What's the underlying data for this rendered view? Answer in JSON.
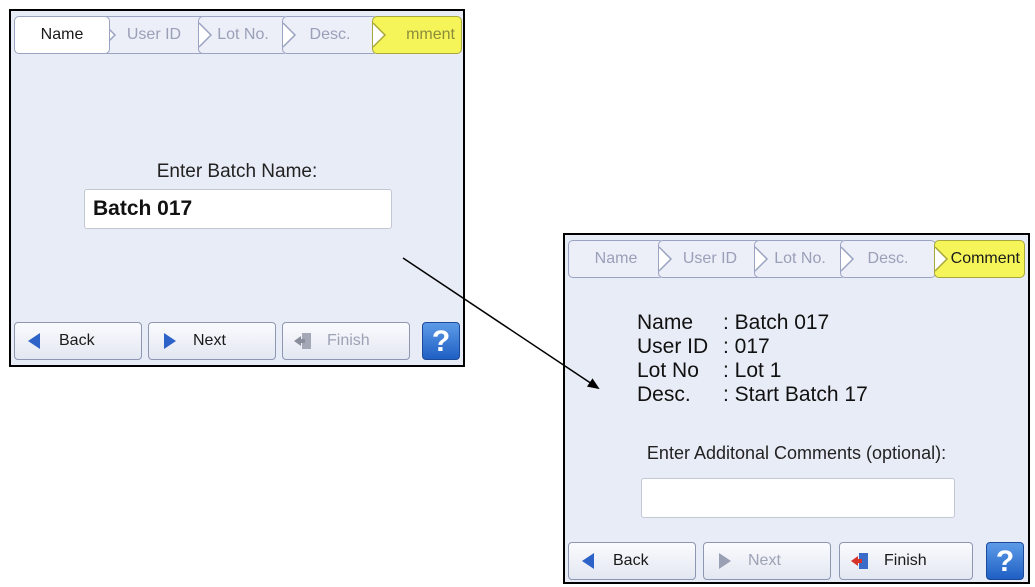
{
  "left_panel": {
    "tabs": [
      "Name",
      "User ID",
      "Lot No.",
      "Desc.",
      "mment"
    ],
    "prompt": "Enter Batch Name:",
    "input_value": "Batch 017",
    "buttons": {
      "back": "Back",
      "next": "Next",
      "finish": "Finish",
      "help": "?"
    }
  },
  "right_panel": {
    "tabs": [
      "Name",
      "User ID",
      "Lot No.",
      "Desc.",
      "Comment"
    ],
    "summary": [
      {
        "key": "Name",
        "value": ": Batch 017"
      },
      {
        "key": "User ID",
        "value": ": 017"
      },
      {
        "key": "Lot No",
        "value": ": Lot 1"
      },
      {
        "key": "Desc.",
        "value": ": Start Batch 17"
      }
    ],
    "prompt": "Enter Additonal Comments (optional):",
    "input_value": "",
    "buttons": {
      "back": "Back",
      "next": "Next",
      "finish": "Finish",
      "help": "?"
    }
  },
  "colors": {
    "panel_bg": "#e8ecf6",
    "comment_tab": "#f5f55a",
    "help_button": "#2f73d6"
  }
}
